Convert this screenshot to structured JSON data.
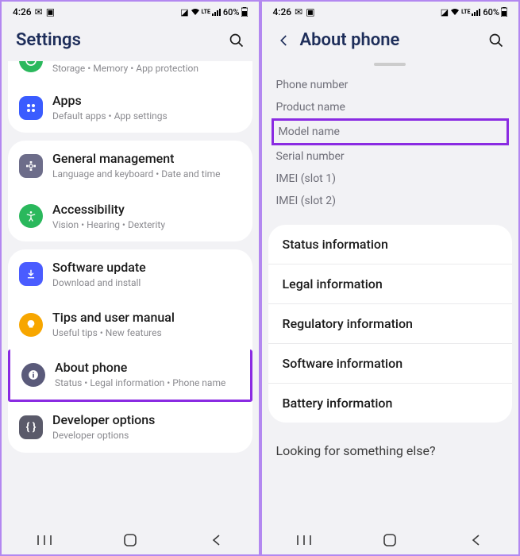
{
  "statusbar": {
    "time": "4:26",
    "battery": "60%"
  },
  "left": {
    "title": "Settings",
    "partial_sub": "Storage  •  Memory  •  App protection",
    "items": [
      {
        "icon": "apps",
        "color": "#3a5cff",
        "title": "Apps",
        "sub": "Default apps  •  App settings"
      }
    ],
    "group2": [
      {
        "icon": "gear",
        "color": "#6d6d8a",
        "shape": "square",
        "title": "General management",
        "sub": "Language and keyboard  •  Date and time"
      },
      {
        "icon": "accessibility",
        "color": "#2ab85c",
        "title": "Accessibility",
        "sub": "Vision  •  Hearing  •  Dexterity"
      }
    ],
    "group3": [
      {
        "icon": "download",
        "color": "#4a5cff",
        "shape": "square",
        "title": "Software update",
        "sub": "Download and install"
      },
      {
        "icon": "bulb",
        "color": "#f7a600",
        "title": "Tips and user manual",
        "sub": "Useful tips  •  New features"
      },
      {
        "icon": "info",
        "color": "#5a5a7a",
        "title": "About phone",
        "sub": "Status  •  Legal information  •  Phone name",
        "highlight": true
      },
      {
        "icon": "braces",
        "color": "#5a5a6a",
        "shape": "square",
        "title": "Developer options",
        "sub": "Developer options"
      }
    ]
  },
  "right": {
    "title": "About phone",
    "info": [
      {
        "label": "Phone number"
      },
      {
        "label": "Product name"
      },
      {
        "label": "Model name",
        "highlight": true
      },
      {
        "label": "Serial number"
      },
      {
        "label": "IMEI (slot 1)"
      },
      {
        "label": "IMEI (slot 2)"
      }
    ],
    "nav": [
      "Status information",
      "Legal information",
      "Regulatory information",
      "Software information",
      "Battery information"
    ],
    "footer": "Looking for something else?"
  }
}
